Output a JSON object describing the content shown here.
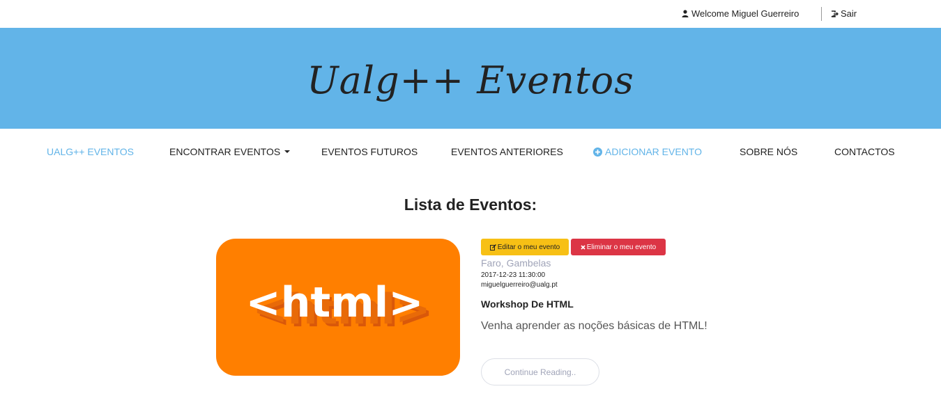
{
  "topbar": {
    "welcome_icon": "user-icon",
    "welcome_text": "Welcome Miguel Guerreiro",
    "logout_icon": "sign-out-icon",
    "logout_text": "Sair"
  },
  "header": {
    "title": "Ualg++ Eventos",
    "banner_color": "#62b4e8"
  },
  "nav": {
    "items": [
      {
        "label": "UALG++ EVENTOS"
      },
      {
        "label": "ENCONTRAR EVENTOS"
      },
      {
        "label": "EVENTOS FUTUROS"
      },
      {
        "label": "EVENTOS ANTERIORES"
      },
      {
        "label": "ADICIONAR EVENTO",
        "icon": "plus-circle-icon"
      },
      {
        "label": "SOBRE NÓS"
      },
      {
        "label": "CONTACTOS"
      }
    ],
    "accent_color": "#62b4e8"
  },
  "main": {
    "list_title": "Lista de Eventos:",
    "event": {
      "image_text": "<html>",
      "image_color": "#ff7f00",
      "edit_label": "Editar o meu evento",
      "delete_label": "Eliminar o meu evento",
      "location": "Faro, Gambelas",
      "datetime": "2017-12-23 11:30:00",
      "email": "miguelguerreiro@ualg.pt",
      "name": "Workshop De HTML",
      "description": "Venha aprender as noções básicas de HTML!",
      "continue_label": "Continue Reading.."
    }
  }
}
